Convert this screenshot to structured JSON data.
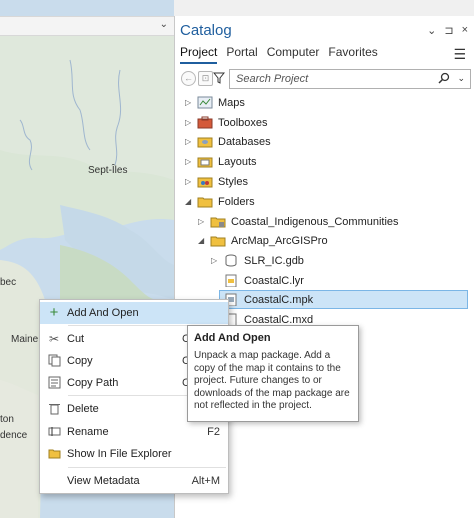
{
  "map": {
    "labels": [
      "Sept-Îles",
      "bec",
      "Maine",
      "ton",
      "dence"
    ]
  },
  "catalog": {
    "title": "Catalog",
    "controls": [
      "⌄",
      "⊐",
      "×"
    ],
    "tabs": [
      "Project",
      "Portal",
      "Computer",
      "Favorites"
    ],
    "active_tab": "Project",
    "search_placeholder": "Search Project",
    "tree": [
      {
        "label": "Maps",
        "icon": "maps-icon"
      },
      {
        "label": "Toolboxes",
        "icon": "toolbox-icon"
      },
      {
        "label": "Databases",
        "icon": "database-icon"
      },
      {
        "label": "Layouts",
        "icon": "layout-icon"
      },
      {
        "label": "Styles",
        "icon": "styles-icon"
      },
      {
        "label": "Folders",
        "icon": "folder-icon"
      },
      {
        "label": "Coastal_Indigenous_Communities",
        "icon": "folder-icon"
      },
      {
        "label": "ArcMap_ArcGISPro",
        "icon": "folder-icon"
      },
      {
        "label": "SLR_IC.gdb",
        "icon": "geodatabase-icon"
      },
      {
        "label": "CoastalC.lyr",
        "icon": "layer-file-icon"
      },
      {
        "label": "CoastalC.mpk",
        "icon": "map-package-icon"
      },
      {
        "label": "CoastalC.mxd",
        "icon": "map-document-icon"
      }
    ]
  },
  "context_menu": {
    "items": [
      {
        "label": "Add And Open",
        "shortcut": "",
        "icon": "plus-icon"
      },
      {
        "label": "Cut",
        "shortcut": "C",
        "icon": "scissors-icon"
      },
      {
        "label": "Copy",
        "shortcut": "C",
        "icon": "copy-icon"
      },
      {
        "label": "Copy Path",
        "shortcut": "C",
        "icon": "copy-path-icon"
      },
      {
        "label": "Delete",
        "shortcut": "",
        "icon": "trash-icon"
      },
      {
        "label": "Rename",
        "shortcut": "F2",
        "icon": "rename-icon"
      },
      {
        "label": "Show In File Explorer",
        "shortcut": "",
        "icon": "folder-open-icon"
      },
      {
        "label": "View Metadata",
        "shortcut": "Alt+M",
        "icon": "metadata-icon"
      }
    ]
  },
  "tooltip": {
    "title": "Add And Open",
    "body": "Unpack a map package. Add a copy of the map it contains to the project. Future changes to or downloads of the map package are not reflected in the project."
  }
}
